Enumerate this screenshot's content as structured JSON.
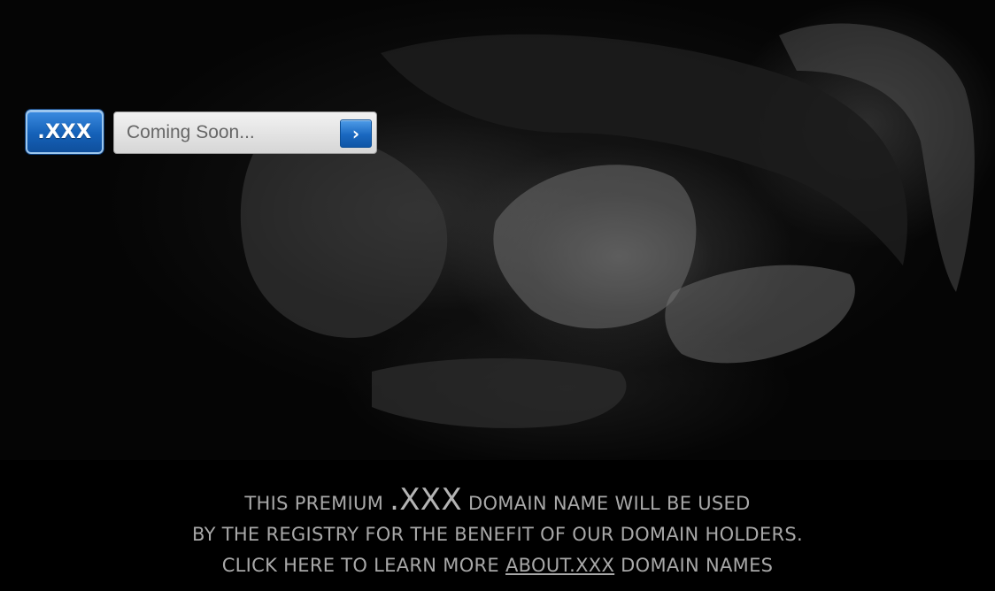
{
  "logo": {
    "text": ".XXX"
  },
  "search": {
    "placeholder": "Coming Soon...",
    "value": "",
    "go_icon": "chevron-right-icon",
    "go_glyph": "›"
  },
  "tagline": {
    "line1_before": "THIS PREMIUM ",
    "line1_highlight": ".XXX",
    "line1_after": " DOMAIN NAME WILL BE USED",
    "line2": "BY THE REGISTRY FOR THE BENEFIT OF OUR DOMAIN HOLDERS.",
    "line3_before": "CLICK HERE TO LEARN MORE ",
    "line3_link": "ABOUT.XXX",
    "line3_after": " DOMAIN NAMES"
  },
  "colors": {
    "background": "#000000",
    "brand_blue": "#1a68c0",
    "tagline_text": "#a8a8a8"
  }
}
